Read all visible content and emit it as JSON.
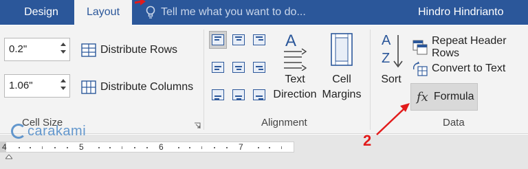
{
  "tabs": {
    "design": "Design",
    "layout": "Layout"
  },
  "tellme": {
    "text": "Tell me what you want to do..."
  },
  "user": {
    "name": "Hindro Hindrianto"
  },
  "cell_size": {
    "height_value": "0.2\"",
    "width_value": "1.06\"",
    "distribute_rows": "Distribute Rows",
    "distribute_columns": "Distribute Columns",
    "group_label": "Cell Size"
  },
  "alignment": {
    "text_direction_line1": "Text",
    "text_direction_line2": "Direction",
    "cell_margins_line1": "Cell",
    "cell_margins_line2": "Margins",
    "group_label": "Alignment"
  },
  "data": {
    "sort": "Sort",
    "repeat_header_rows": "Repeat Header Rows",
    "convert_to_text": "Convert to Text",
    "formula": "Formula",
    "group_label": "Data"
  },
  "ruler": {
    "numbers": [
      "4",
      "5",
      "6",
      "7"
    ]
  },
  "watermark": {
    "text": "carakami"
  },
  "annotation": {
    "step": "2"
  },
  "colors": {
    "title_bar": "#2b579a",
    "ribbon": "#f3f3f3",
    "annotation": "#e21b1b"
  }
}
